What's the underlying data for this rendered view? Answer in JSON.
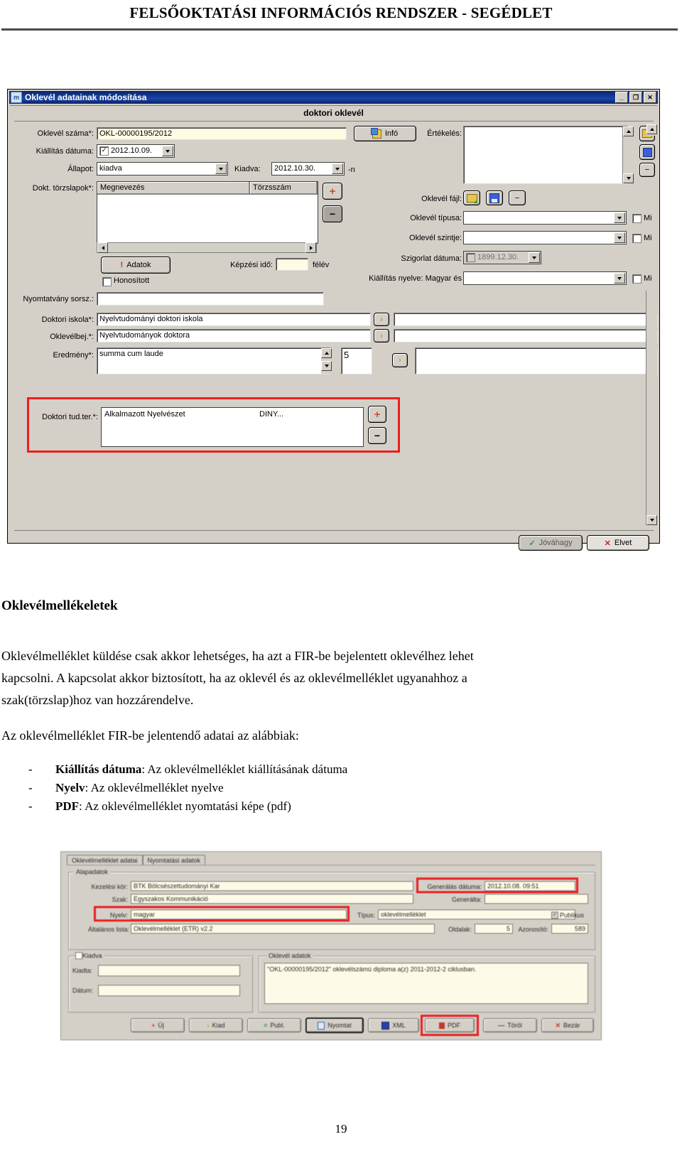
{
  "page": {
    "header_title": "FELSŐOKTATÁSI INFORMÁCIÓS RENDSZER -  SEGÉDLET",
    "page_number": "19"
  },
  "dialog1": {
    "window_title": "Oklevél adatainak módosítása",
    "app_icon": "m",
    "subtitle": "doktori oklevél",
    "titlebar_buttons": {
      "minimize": "_",
      "maximize": "❐",
      "close": "✕"
    },
    "fields": {
      "oklevel_szama_label": "Oklevél száma*:",
      "oklevel_szama_value": "OKL-00000195/2012",
      "kiallitas_datuma_label": "Kiállítás dátuma:",
      "kiallitas_datuma_value": "2012.10.09.",
      "allapot_label": "Állapot:",
      "allapot_value": "kiadva",
      "kiadva_label": "Kiadva:",
      "kiadva_value": "2012.10.30.",
      "kiadva_suffix": "-n",
      "dokt_torzslapok_label": "Dokt. törzslapok*:",
      "col_megnevezes": "Megnevezés",
      "col_torzsszam": "Törzsszám",
      "adatok_button": "Adatok",
      "adatok_badge": "!",
      "kepzesi_ido_label": "Képzési idő:",
      "kepzesi_ido_value": "",
      "kepzesi_ido_suffix": "félév",
      "honositott_label": "Honosított",
      "nyomtatvany_sorsz_label": "Nyomtatvány sorsz.:",
      "nyomtatvany_sorsz_value": "",
      "doktori_iskola_label": "Doktori iskola*:",
      "doktori_iskola_value": "Nyelvtudományi doktori iskola",
      "oklevelbej_label": "Oklevélbej.*:",
      "oklevelbej_value": "Nyelvtudományok doktora",
      "eredmeny_label": "Eredmény*:",
      "eredmeny_value": "summa cum laude",
      "eredmeny_number": "5",
      "doktori_tud_ter_label": "Doktori tud.ter.*:",
      "doktori_tud_ter_value": "Alkalmazott Nyelvészet",
      "doktori_tud_ter_code": "DINY...",
      "info_button": "Infó",
      "ertekeles_label": "Értékelés:",
      "ertekeles_value": "",
      "oklevel_fajl_label": "Oklevél fájl:",
      "oklevel_tipusa_label": "Oklevél típusa:",
      "oklevel_tipusa_value": "",
      "oklevel_szintje_label": "Oklevél szintje:",
      "oklevel_szintje_value": "",
      "szigorlat_datuma_label": "Szigorlat dátuma:",
      "szigorlat_datuma_value": "1899.12.30.",
      "kiallitas_nyelve_label": "Kiállítás nyelve: Magyar és",
      "kiallitas_nyelve_value": "",
      "mi_checkbox_label": "Mi"
    },
    "buttons": {
      "jovahagy": "Jóváhagy",
      "elvet": "Elvet",
      "plus": "+",
      "minus": "−",
      "chevron": "›"
    }
  },
  "body": {
    "heading": "Oklevélmellékeletek",
    "paragraph1_line1": "Oklevélmelléklet küldése csak akkor lehetséges, ha azt a FIR-be bejelentett oklevélhez lehet",
    "paragraph1_line2": "kapcsolni. A kapcsolat akkor biztosított, ha az oklevél és az oklevélmelléklet ugyanahhoz a",
    "paragraph1_line3": "szak(törzslap)hoz van hozzárendelve.",
    "paragraph2": "Az oklevélmelléklet FIR-be jelentendő adatai az alábbiak:",
    "bullets": [
      {
        "dash": "-",
        "bold": "Kiállítás dátuma",
        "rest": ": Az oklevélmelléklet kiállításának dátuma"
      },
      {
        "dash": "-",
        "bold": "Nyelv",
        "rest": ": Az oklevélmelléklet nyelve"
      },
      {
        "dash": "-",
        "bold": "PDF",
        "rest": ": Az oklevélmelléklet nyomtatási képe (pdf)"
      }
    ]
  },
  "dialog2": {
    "tabs": [
      {
        "label": "Oklevélmelléklet adatai",
        "active": true
      },
      {
        "label": "Nyomtatási adatok",
        "active": false
      }
    ],
    "groups": {
      "alapadatok": "Alapadatok",
      "kiadva": "Kiadva",
      "oklevel_adatok": "Oklevél adatok"
    },
    "fields": {
      "kezelesi_kor_label": "Kezelési kör:",
      "kezelesi_kor_value": "BTK Bölcsészettudományi Kar",
      "szak_label": "Szak:",
      "szak_value": "Egyszakos Kommunikáció",
      "nyelv_label": "Nyelv:",
      "nyelv_value": "magyar",
      "tipus_label": "Típus:",
      "tipus_value": "oklevélmelléklet",
      "publikus_label": "Publikus",
      "altalanos_lista_label": "Általános lista:",
      "altalanos_lista_value": "Oklevélmelléklet (ETR) v2.2",
      "oldalak_label": "Oldalak:",
      "oldalak_value": "5",
      "azonosito_label": "Azonosító:",
      "azonosito_value": "589",
      "generalas_datuma_label": "Generálás dátuma:",
      "generalas_datuma_value": "2012.10.08. 09:51",
      "generalta_label": "Generálta:",
      "generalta_value": "",
      "kiadta_label": "Kiadta:",
      "kiadta_value": "",
      "datum_label": "Dátum:",
      "datum_value": "",
      "oklevel_adatok_text": "\"OKL-00000195/2012\" oklevélszámú diploma a(z) 2011-2012-2 ciklusban."
    },
    "toolbar": [
      {
        "label": "Új",
        "icon": "plus-icon",
        "glyph": "+",
        "color": "#d14b3c",
        "highlight": false,
        "focus": false
      },
      {
        "label": "Kiad",
        "icon": "chevron-right-icon",
        "glyph": "›",
        "color": "#c8922b",
        "highlight": false,
        "focus": false
      },
      {
        "label": "Publ.",
        "icon": "list-icon",
        "glyph": "≡",
        "color": "#2f8f3f",
        "highlight": false,
        "focus": false
      },
      {
        "label": "Nyomtat",
        "icon": "printer-icon",
        "glyph": "❏",
        "color": "#3a5fa8",
        "highlight": false,
        "focus": true
      },
      {
        "label": "XML",
        "icon": "save-icon",
        "glyph": "❏",
        "color": "#2741a8",
        "highlight": false,
        "focus": false
      },
      {
        "label": "PDF",
        "icon": "pdf-icon",
        "glyph": "⬓",
        "color": "#c0392b",
        "highlight": true,
        "focus": false
      },
      {
        "label": "Töröl",
        "icon": "minus-icon",
        "glyph": "—",
        "color": "#444444",
        "highlight": false,
        "focus": false
      },
      {
        "label": "Bezár",
        "icon": "close-icon",
        "glyph": "✕",
        "color": "#c0392b",
        "highlight": false,
        "focus": false
      }
    ]
  },
  "colors": {
    "titlebar": "#0a246a",
    "dialog_face": "#d4d0c8",
    "highlight_red": "#ee1c1c",
    "field_yellow": "#fdfbe2"
  }
}
